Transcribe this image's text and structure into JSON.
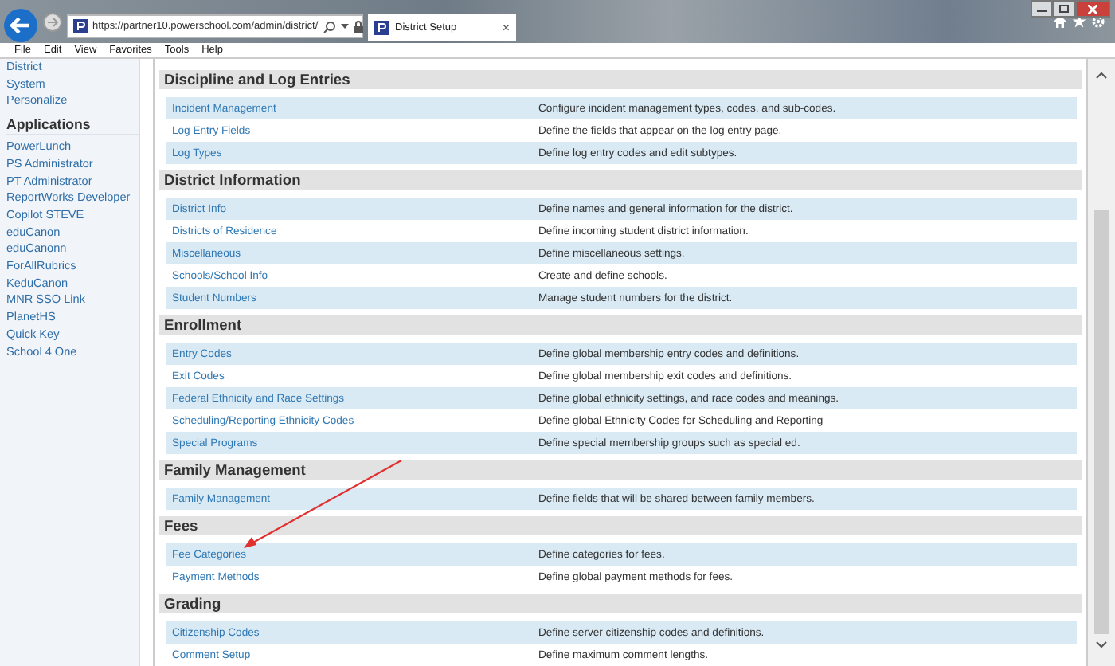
{
  "browser": {
    "address": "https://partner10.powerschool.com/admin/district/",
    "tab": {
      "title": "District Setup",
      "close": "×"
    },
    "menu": [
      "File",
      "Edit",
      "View",
      "Favorites",
      "Tools",
      "Help"
    ]
  },
  "sidebar": {
    "links": [
      "District",
      "System",
      "Personalize"
    ],
    "heading": "Applications",
    "applications": [
      "PowerLunch",
      "PS Administrator",
      "PT Administrator",
      "ReportWorks Developer",
      "Copilot STEVE",
      "eduCanon",
      "eduCanonn",
      "ForAllRubrics",
      "KeduCanon",
      "MNR SSO Link",
      "PlanetHS",
      "Quick Key",
      "School 4 One"
    ]
  },
  "sections": [
    {
      "title": "Discipline and Log Entries",
      "rows": [
        {
          "name": "Incident Management",
          "description": "Configure incident management types, codes, and sub-codes."
        },
        {
          "name": "Log Entry Fields",
          "description": "Define the fields that appear on the log entry page."
        },
        {
          "name": "Log Types",
          "description": "Define log entry codes and edit subtypes."
        }
      ]
    },
    {
      "title": "District Information",
      "rows": [
        {
          "name": "District Info",
          "description": "Define names and general information for the district."
        },
        {
          "name": "Districts of Residence",
          "description": "Define incoming student district information."
        },
        {
          "name": "Miscellaneous",
          "description": "Define miscellaneous settings."
        },
        {
          "name": "Schools/School Info",
          "description": "Create and define schools."
        },
        {
          "name": "Student Numbers",
          "description": "Manage student numbers for the district."
        }
      ]
    },
    {
      "title": "Enrollment",
      "rows": [
        {
          "name": "Entry Codes",
          "description": "Define global membership entry codes and definitions."
        },
        {
          "name": "Exit Codes",
          "description": "Define global membership exit codes and definitions."
        },
        {
          "name": "Federal Ethnicity and Race Settings",
          "description": "Define global ethnicity settings, and race codes and meanings."
        },
        {
          "name": "Scheduling/Reporting Ethnicity Codes",
          "description": "Define global Ethnicity Codes for Scheduling and Reporting"
        },
        {
          "name": "Special Programs",
          "description": "Define special membership groups such as special ed."
        }
      ]
    },
    {
      "title": "Family Management",
      "rows": [
        {
          "name": "Family Management",
          "description": "Define fields that will be shared between family members."
        }
      ]
    },
    {
      "title": "Fees",
      "rows": [
        {
          "name": "Fee Categories",
          "description": "Define categories for fees."
        },
        {
          "name": "Payment Methods",
          "description": "Define global payment methods for fees."
        }
      ]
    },
    {
      "title": "Grading",
      "rows": [
        {
          "name": "Citizenship Codes",
          "description": "Define server citizenship codes and definitions."
        },
        {
          "name": "Comment Setup",
          "description": "Define maximum comment lengths."
        }
      ]
    }
  ]
}
